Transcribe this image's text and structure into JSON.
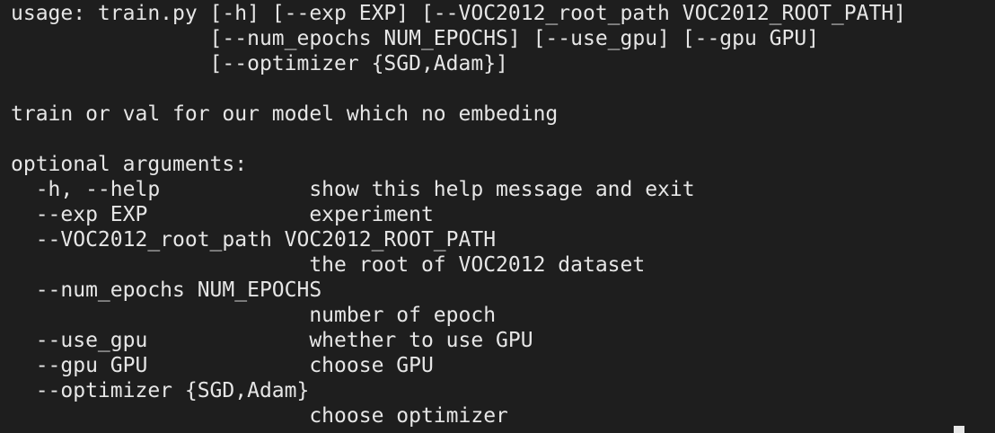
{
  "terminal": {
    "lines": [
      "usage: train.py [-h] [--exp EXP] [--VOC2012_root_path VOC2012_ROOT_PATH]",
      "                [--num_epochs NUM_EPOCHS] [--use_gpu] [--gpu GPU]",
      "                [--optimizer {SGD,Adam}]",
      "",
      "train or val for our model which no embeding",
      "",
      "optional arguments:",
      "  -h, --help            show this help message and exit",
      "  --exp EXP             experiment",
      "  --VOC2012_root_path VOC2012_ROOT_PATH",
      "                        the root of VOC2012 dataset",
      "  --num_epochs NUM_EPOCHS",
      "                        number of epoch",
      "  --use_gpu             whether to use GPU",
      "  --gpu GPU             choose GPU",
      "  --optimizer {SGD,Adam}",
      "                        choose optimizer"
    ]
  },
  "colors": {
    "background": "#1e1e1e",
    "text": "#e6e6e6",
    "prompt_accent": "#3fd0c8"
  }
}
